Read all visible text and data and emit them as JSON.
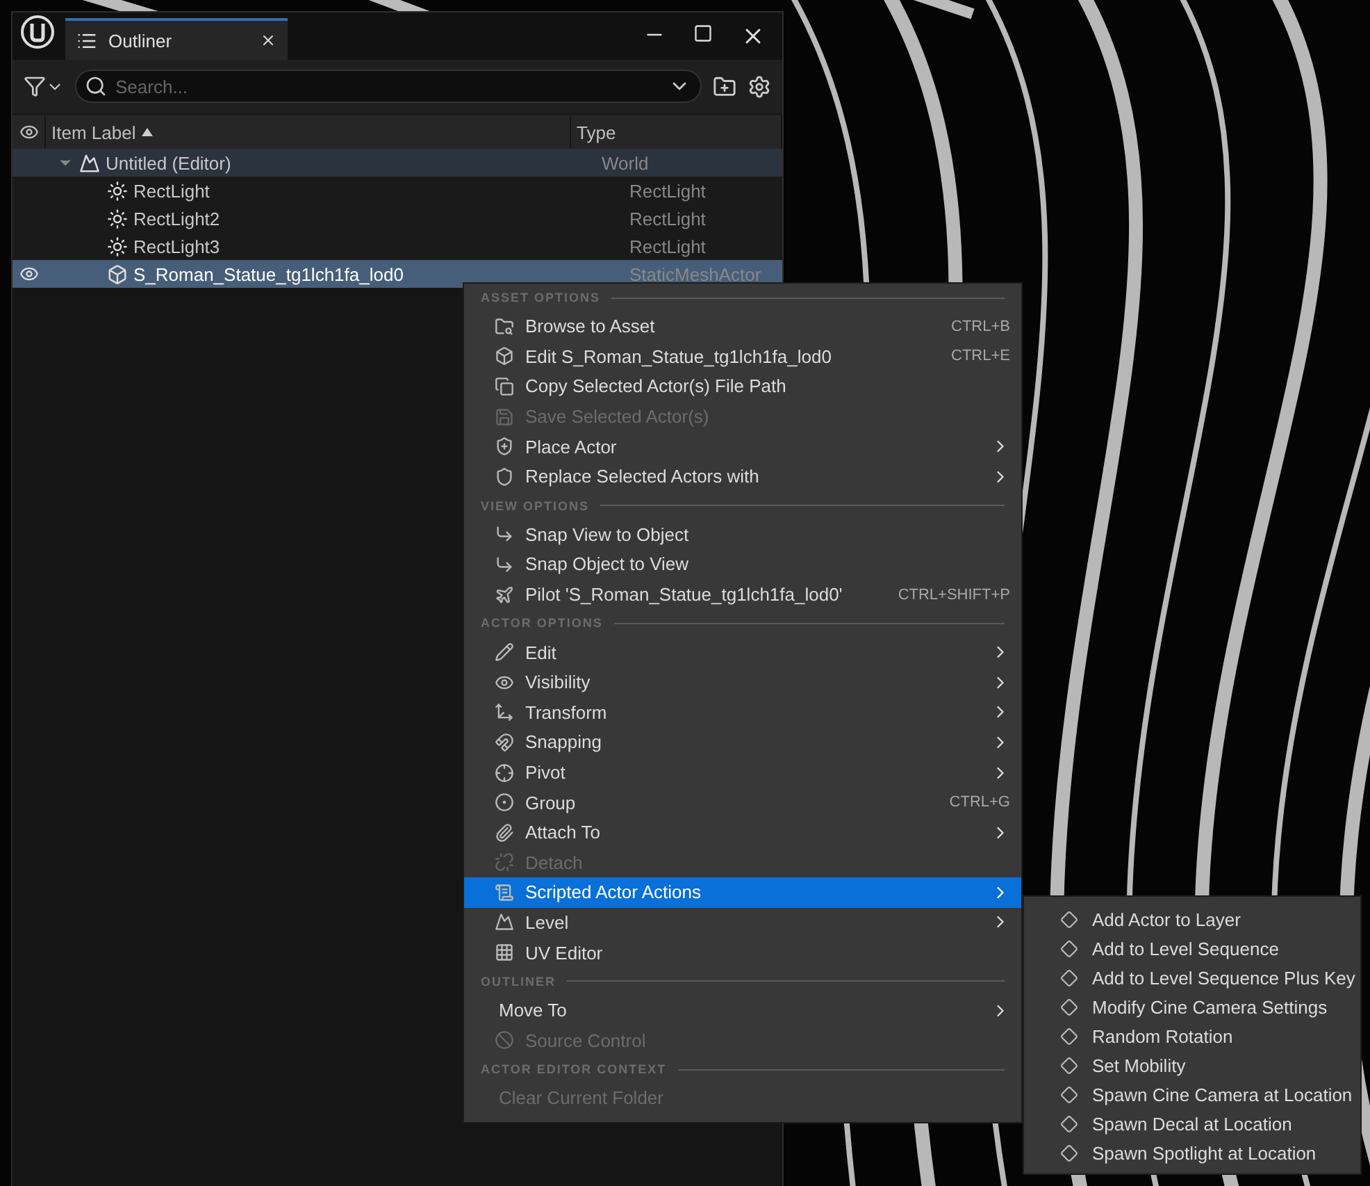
{
  "window": {
    "tab": "Outliner"
  },
  "toolbar": {
    "search": {
      "placeholder": "Search..."
    }
  },
  "outliner": {
    "columns": [
      "Item Label",
      "Type"
    ],
    "rows": [
      {
        "label": "Untitled (Editor)",
        "type": "World",
        "kind": "world",
        "selected": false,
        "visible": false,
        "expanded": true,
        "children": [
          {
            "label": "RectLight",
            "type": "RectLight",
            "kind": "light",
            "selected": false,
            "visible": false
          },
          {
            "label": "RectLight2",
            "type": "RectLight",
            "kind": "light",
            "selected": false,
            "visible": false
          },
          {
            "label": "RectLight3",
            "type": "RectLight",
            "kind": "light",
            "selected": false,
            "visible": false
          },
          {
            "label": "S_Roman_Statue_tg1lch1fa_lod0",
            "type": "StaticMeshActor",
            "kind": "mesh",
            "selected": true,
            "visible": true
          }
        ]
      }
    ]
  },
  "context_menu": {
    "sections": [
      {
        "title": "ASSET OPTIONS",
        "items": [
          {
            "label": "Browse to Asset",
            "shortcut": "CTRL+B",
            "submenu": false,
            "disabled": false,
            "selected": false
          },
          {
            "label": "Edit S_Roman_Statue_tg1lch1fa_lod0",
            "shortcut": "CTRL+E",
            "submenu": false,
            "disabled": false,
            "selected": false
          },
          {
            "label": "Copy Selected Actor(s) File Path",
            "submenu": false,
            "disabled": false,
            "selected": false
          },
          {
            "label": "Save Selected Actor(s)",
            "submenu": false,
            "disabled": true,
            "selected": false
          },
          {
            "label": "Place Actor",
            "submenu": true,
            "disabled": false,
            "selected": false
          },
          {
            "label": "Replace Selected Actors with",
            "submenu": true,
            "disabled": false,
            "selected": false
          }
        ]
      },
      {
        "title": "VIEW OPTIONS",
        "items": [
          {
            "label": "Snap View to Object",
            "submenu": false,
            "disabled": false,
            "selected": false
          },
          {
            "label": "Snap Object to View",
            "submenu": false,
            "disabled": false,
            "selected": false
          },
          {
            "label": "Pilot 'S_Roman_Statue_tg1lch1fa_lod0'",
            "shortcut": "CTRL+SHIFT+P",
            "submenu": false,
            "disabled": false,
            "selected": false
          }
        ]
      },
      {
        "title": "ACTOR OPTIONS",
        "items": [
          {
            "label": "Edit",
            "submenu": true,
            "disabled": false,
            "selected": false
          },
          {
            "label": "Visibility",
            "submenu": true,
            "disabled": false,
            "selected": false
          },
          {
            "label": "Transform",
            "submenu": true,
            "disabled": false,
            "selected": false
          },
          {
            "label": "Snapping",
            "submenu": true,
            "disabled": false,
            "selected": false
          },
          {
            "label": "Pivot",
            "submenu": true,
            "disabled": false,
            "selected": false
          },
          {
            "label": "Group",
            "shortcut": "CTRL+G",
            "submenu": false,
            "disabled": false,
            "selected": false
          },
          {
            "label": "Attach To",
            "submenu": true,
            "disabled": false,
            "selected": false
          },
          {
            "label": "Detach",
            "submenu": false,
            "disabled": true,
            "selected": false
          },
          {
            "label": "Scripted Actor Actions",
            "submenu": true,
            "disabled": false,
            "selected": true
          },
          {
            "label": "Level",
            "submenu": true,
            "disabled": false,
            "selected": false
          },
          {
            "label": "UV Editor",
            "submenu": false,
            "disabled": false,
            "selected": false
          }
        ]
      },
      {
        "title": "OUTLINER",
        "items": [
          {
            "label": "Move To",
            "submenu": true,
            "disabled": false,
            "selected": false
          },
          {
            "label": "Source Control",
            "submenu": false,
            "disabled": true,
            "selected": false
          }
        ]
      },
      {
        "title": "ACTOR EDITOR CONTEXT",
        "items": [
          {
            "label": "Clear Current Folder",
            "submenu": false,
            "disabled": true,
            "selected": false
          }
        ]
      }
    ]
  },
  "submenu": {
    "items": [
      "Add Actor to Layer",
      "Add to Level Sequence",
      "Add to Level Sequence Plus Key",
      "Modify Cine Camera Settings",
      "Random Rotation",
      "Set Mobility",
      "Spawn Cine Camera at Location",
      "Spawn Decal at Location",
      "Spawn Spotlight at Location"
    ]
  }
}
